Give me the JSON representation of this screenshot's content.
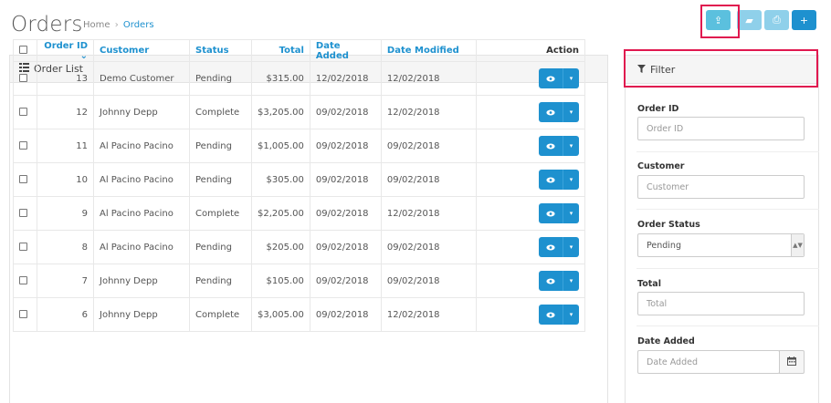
{
  "header": {
    "title": "Orders",
    "breadcrumb": [
      {
        "label": "Home"
      },
      {
        "label": "Orders"
      }
    ],
    "breadcrumb_sep": "›"
  },
  "toolbar": {
    "buttons": [
      {
        "icon": "upload-icon",
        "glyph": "⇪"
      },
      {
        "icon": "truck-icon",
        "glyph": "▰"
      },
      {
        "icon": "print-icon",
        "glyph": "⎙"
      },
      {
        "icon": "plus-icon",
        "glyph": "+"
      }
    ]
  },
  "order_list": {
    "heading": "Order List",
    "heading_icon": "list-icon",
    "columns": {
      "order_id": "Order ID",
      "sort_indicator": "⌄",
      "customer": "Customer",
      "status": "Status",
      "total": "Total",
      "date_added": "Date Added",
      "date_modified": "Date Modified",
      "action": "Action"
    },
    "rows": [
      {
        "id": "13",
        "customer": "Demo Customer",
        "status": "Pending",
        "total": "$315.00",
        "date_added": "12/02/2018",
        "date_modified": "12/02/2018"
      },
      {
        "id": "12",
        "customer": "Johnny Depp",
        "status": "Complete",
        "total": "$3,205.00",
        "date_added": "09/02/2018",
        "date_modified": "12/02/2018"
      },
      {
        "id": "11",
        "customer": "Al Pacino Pacino",
        "status": "Pending",
        "total": "$1,005.00",
        "date_added": "09/02/2018",
        "date_modified": "09/02/2018"
      },
      {
        "id": "10",
        "customer": "Al Pacino Pacino",
        "status": "Pending",
        "total": "$305.00",
        "date_added": "09/02/2018",
        "date_modified": "09/02/2018"
      },
      {
        "id": "9",
        "customer": "Al Pacino Pacino",
        "status": "Complete",
        "total": "$2,205.00",
        "date_added": "09/02/2018",
        "date_modified": "12/02/2018"
      },
      {
        "id": "8",
        "customer": "Al Pacino Pacino",
        "status": "Pending",
        "total": "$205.00",
        "date_added": "09/02/2018",
        "date_modified": "09/02/2018"
      },
      {
        "id": "7",
        "customer": "Johnny Depp",
        "status": "Pending",
        "total": "$105.00",
        "date_added": "09/02/2018",
        "date_modified": "09/02/2018"
      },
      {
        "id": "6",
        "customer": "Johnny Depp",
        "status": "Complete",
        "total": "$3,005.00",
        "date_added": "09/02/2018",
        "date_modified": "12/02/2018"
      }
    ]
  },
  "filter": {
    "heading": "Filter",
    "heading_icon": "filter-icon",
    "order_id": {
      "label": "Order ID",
      "placeholder": "Order ID"
    },
    "customer": {
      "label": "Customer",
      "placeholder": "Customer"
    },
    "order_status": {
      "label": "Order Status",
      "value": "Pending"
    },
    "total": {
      "label": "Total",
      "placeholder": "Total"
    },
    "date_added": {
      "label": "Date Added",
      "placeholder": "Date Added"
    }
  },
  "colors": {
    "primary": "#1e91cf",
    "info": "#5bc0de",
    "highlight": "#e0184f"
  }
}
